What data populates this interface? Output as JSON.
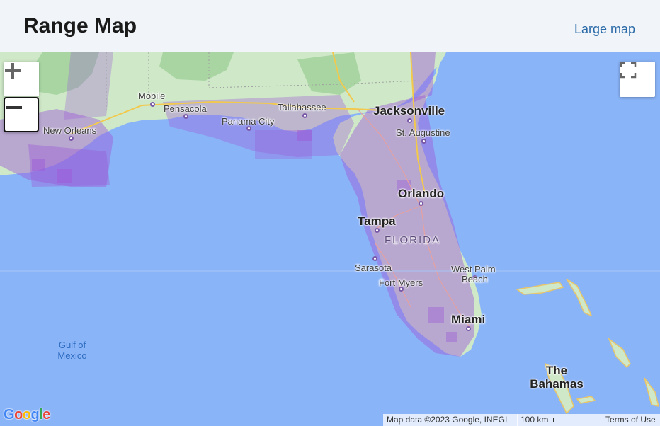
{
  "header": {
    "title": "Range Map",
    "large_map_link": "Large map"
  },
  "map": {
    "controls": {
      "zoom_in": "+",
      "zoom_out": "−"
    },
    "labels": {
      "mobile": "Mobile",
      "pensacola": "Pensacola",
      "new_orleans": "New Orleans",
      "tallahassee": "Tallahassee",
      "panama_city": "Panama City",
      "jacksonville": "Jacksonville",
      "st_augustine": "St. Augustine",
      "orlando": "Orlando",
      "tampa": "Tampa",
      "florida": "FLORIDA",
      "sarasota": "Sarasota",
      "west_palm": "West Palm",
      "beach": "Beach",
      "fort_myers": "Fort Myers",
      "miami": "Miami",
      "gulf_line1": "Gulf of",
      "gulf_line2": "Mexico",
      "bahamas_line1": "The",
      "bahamas_line2": "Bahamas"
    },
    "attribution": {
      "map_data": "Map data ©2023 Google, INEGI",
      "scale": "100 km",
      "terms": "Terms of Use",
      "logo": "Google"
    },
    "colors": {
      "water": "#8ab4f8",
      "land": "#cfe8c8",
      "range": "#9b59d6",
      "link": "#2b6aa8"
    }
  }
}
